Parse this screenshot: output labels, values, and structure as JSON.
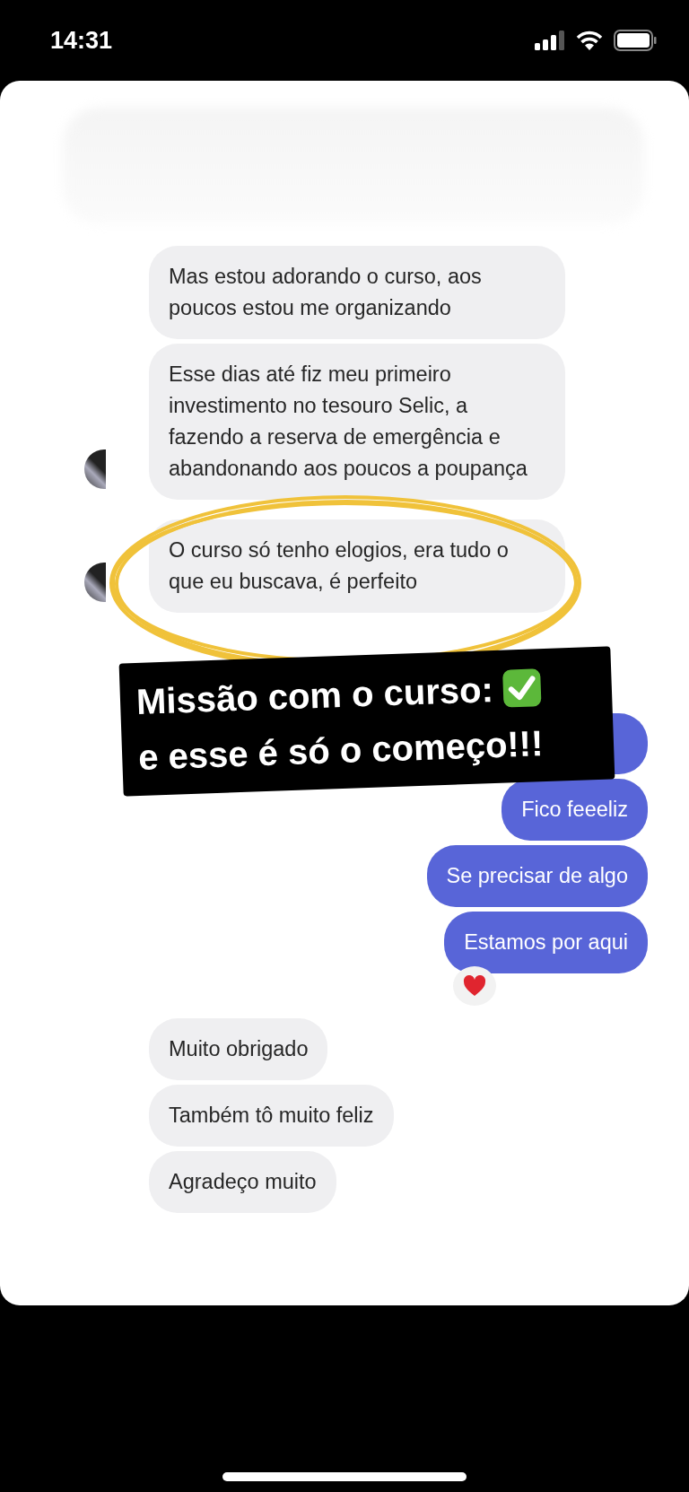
{
  "status_bar": {
    "time": "14:31"
  },
  "messages": [
    {
      "kind": "received",
      "avatar": false,
      "text": "Mas estou adorando o curso, aos poucos estou me organizando"
    },
    {
      "kind": "received",
      "avatar": true,
      "text": "Esse dias até fiz meu primeiro investimento no tesouro Selic, a fazendo a reserva de emergência e abandonando aos poucos a poupança"
    },
    {
      "kind": "received",
      "avatar": true,
      "text": "O curso só tenho elogios, era tudo o que eu buscava, é perfeito"
    },
    {
      "kind": "sent",
      "reacted": false
    },
    {
      "kind": "sent",
      "reacted": false,
      "text": "Fico feeeliz"
    },
    {
      "kind": "sent",
      "reacted": false,
      "text": "Se precisar de algo"
    },
    {
      "kind": "sent",
      "reacted": true,
      "text": "Estamos por aqui"
    },
    {
      "kind": "received",
      "avatar": false,
      "text": "Muito obrigado"
    },
    {
      "kind": "received",
      "avatar": false,
      "text": "Também tô muito feliz"
    },
    {
      "kind": "received",
      "avatar": false,
      "text": "Agradeço muito"
    }
  ],
  "caption": {
    "lines": [
      "Missão com o curso:",
      "e esse é só o começo!!!"
    ]
  }
}
